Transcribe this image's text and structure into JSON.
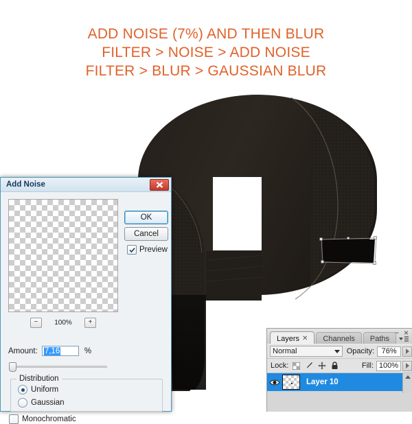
{
  "heading": {
    "line1": "ADD NOISE (7%) AND THEN BLUR",
    "line2": "FILTER > NOISE > ADD NOISE",
    "line3": "FILTER > BLUR > GAUSSIAN BLUR",
    "color": "#e0622a"
  },
  "artwork": {
    "description": "dark rounded dome shape with mesh texture panels",
    "body_color": "#2a2520",
    "panel_color": "#211d19",
    "edge_color": "#6b5f50"
  },
  "dialog": {
    "title": "Add Noise",
    "close_icon": "close-icon",
    "ok_label": "OK",
    "cancel_label": "Cancel",
    "preview_label": "Preview",
    "preview_checked": true,
    "zoom_minus": "−",
    "zoom_level": "100%",
    "zoom_plus": "+",
    "amount_label": "Amount:",
    "amount_value": "7,16",
    "amount_unit": "%",
    "distribution_label": "Distribution",
    "uniform_label": "Uniform",
    "gaussian_label": "Gaussian",
    "distribution_selected": "Uniform",
    "monochromatic_label": "Monochromatic",
    "monochromatic_checked": false
  },
  "layers_panel": {
    "tabs": [
      {
        "label": "Layers",
        "active": true,
        "closable": true
      },
      {
        "label": "Channels",
        "active": false,
        "closable": false
      },
      {
        "label": "Paths",
        "active": false,
        "closable": false
      }
    ],
    "minimize_icon": "−",
    "close_icon": "×",
    "menu_icon": "panel-menu-icon",
    "blend_mode": "Normal",
    "opacity_label": "Opacity:",
    "opacity_value": "76%",
    "lock_label": "Lock:",
    "lock_icons": [
      "lock-transparency-icon",
      "lock-pixels-icon",
      "lock-position-icon",
      "lock-all-icon"
    ],
    "fill_label": "Fill:",
    "fill_value": "100%",
    "layers": [
      {
        "name": "Layer 10",
        "visible": true,
        "selected": true
      }
    ]
  }
}
